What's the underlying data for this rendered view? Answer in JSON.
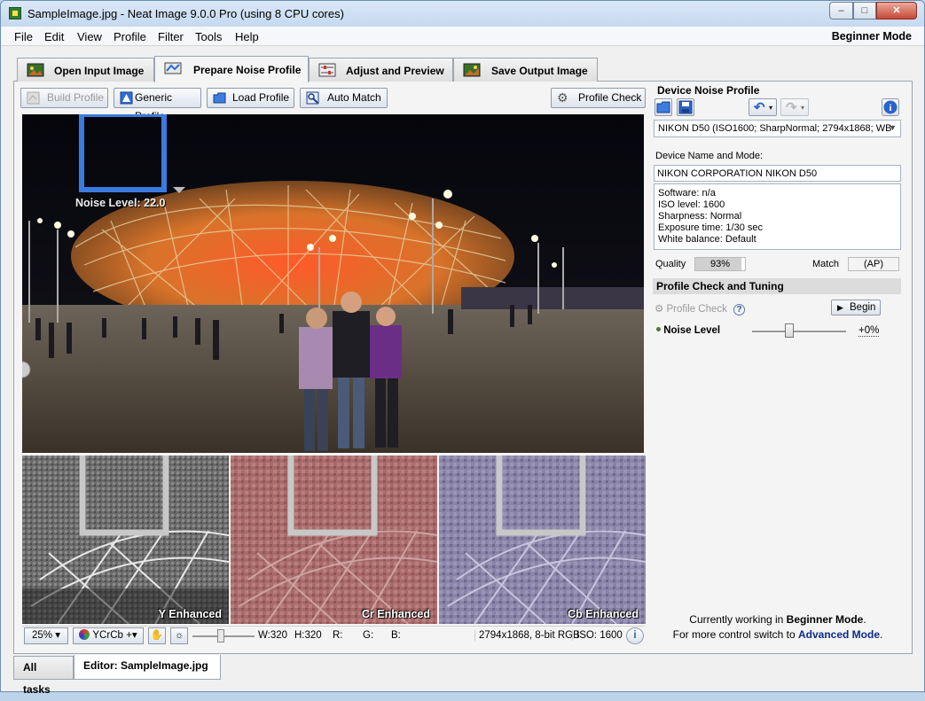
{
  "window": {
    "title": "SampleImage.jpg - Neat Image 9.0.0 Pro (using 8 CPU cores)",
    "minimize": "‒",
    "maximize": "□",
    "close": "✕"
  },
  "menu": {
    "items": [
      "File",
      "Edit",
      "View",
      "Profile",
      "Filter",
      "Tools",
      "Help"
    ],
    "mode": "Beginner Mode"
  },
  "tabs": [
    {
      "label": "Open Input Image",
      "icon": "open-image-icon"
    },
    {
      "label": "Prepare Noise Profile",
      "icon": "noise-profile-icon"
    },
    {
      "label": "Adjust and Preview",
      "icon": "adjust-sliders-icon"
    },
    {
      "label": "Save Output Image",
      "icon": "save-image-icon"
    }
  ],
  "toolbar": {
    "build_profile": "Build Profile",
    "generic_profile": "Generic Profile",
    "load_profile": "Load Profile",
    "auto_match": "Auto Match",
    "profile_check": "Profile Check"
  },
  "preview": {
    "noise_level_label": "Noise Level: 22.0",
    "sub_labels": [
      "Y Enhanced",
      "Cr Enhanced",
      "Cb Enhanced"
    ]
  },
  "statusbar": {
    "zoom": "25%",
    "channel": "YCrCb +",
    "w": "W:320",
    "h": "H:320",
    "r": "R:",
    "g": "G:",
    "b": "B:",
    "dimensions": "2794x1868, 8-bit RGB",
    "iso": "ISO: 1600"
  },
  "device_profile": {
    "title": "Device Noise Profile",
    "selected_profile": "NIKON D50 (ISO1600; SharpNormal; 2794x1868; WB",
    "name_mode_label": "Device Name and Mode:",
    "name_mode_value": "NIKON CORPORATION NIKON D50",
    "info_lines": [
      "Software: n/a",
      "ISO level: 1600",
      "Sharpness: Normal",
      "Exposure time: 1/30 sec",
      "White balance: Default"
    ],
    "quality_label": "Quality",
    "quality_value": "93%",
    "match_label": "Match",
    "match_value": "(AP)"
  },
  "tuning": {
    "section_title": "Profile Check and Tuning",
    "profile_check_label": "Profile Check",
    "begin_button": "Begin",
    "noise_level_label": "Noise Level",
    "noise_level_value": "+0%"
  },
  "mode_note": {
    "line1_prefix": "Currently working in ",
    "line1_mode": "Beginner Mode",
    "line1_suffix": ".",
    "line2_prefix": "For more control switch to ",
    "line2_link": "Advanced Mode",
    "line2_suffix": "."
  },
  "bottom_tabs": [
    "All tasks",
    "Editor: SampleImage.jpg"
  ],
  "colors": {
    "accent_blue": "#3a7be0",
    "link_blue": "#0b2a8c",
    "y_tint": "#7a7a7a",
    "cr_tint": "#a86a6a",
    "cb_tint": "#8a84a8"
  }
}
